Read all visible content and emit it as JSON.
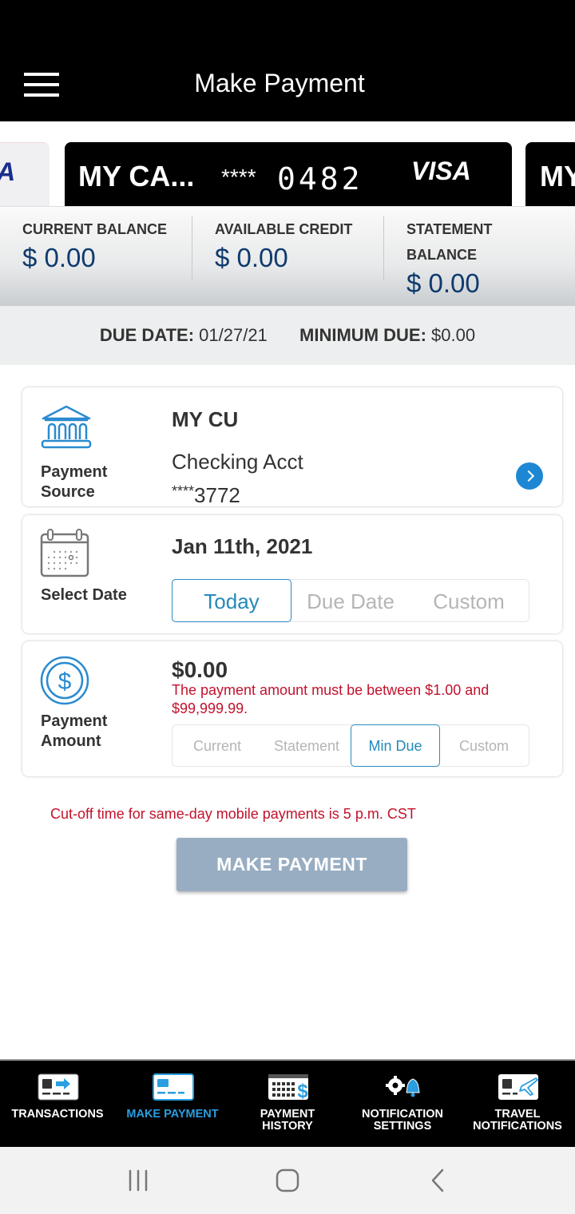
{
  "header": {
    "title": "Make Payment",
    "menu_icon": "hamburger-menu-icon"
  },
  "cards": {
    "prev_partial_brand": "A",
    "current": {
      "name": "MY CA...",
      "mask": "****",
      "last4": "0482",
      "brand": "VISA"
    },
    "next_partial_name": "MY"
  },
  "balances": {
    "current": {
      "label": "CURRENT BALANCE",
      "value": "$ 0.00"
    },
    "available": {
      "label": "AVAILABLE CREDIT",
      "value": "$ 0.00"
    },
    "statement": {
      "label_line1": "STATEMENT",
      "label_line2": "BALANCE",
      "value": "$ 0.00"
    }
  },
  "due": {
    "due_date_label": "DUE DATE:",
    "due_date_value": "01/27/21",
    "min_due_label": "MINIMUM DUE:",
    "min_due_value": "$0.00"
  },
  "payment_source": {
    "icon": "bank-icon",
    "label_line1": "Payment",
    "label_line2": "Source",
    "institution": "MY CU",
    "account_name": "Checking Acct",
    "account_mask": "****",
    "account_last4": "3772"
  },
  "select_date": {
    "icon": "calendar-icon",
    "label": "Select Date",
    "selected_date": "Jan 11th, 2021",
    "options": [
      "Today",
      "Due Date",
      "Custom"
    ],
    "active_option": "Today"
  },
  "payment_amount": {
    "icon": "dollar-coin-icon",
    "label_line1": "Payment",
    "label_line2": "Amount",
    "amount": "$0.00",
    "error": "The payment amount must be between $1.00 and $99,999.99.",
    "options": [
      "Current",
      "Statement",
      "Min Due",
      "Custom"
    ],
    "active_option": "Min Due"
  },
  "cutoff_notice": "Cut-off time for same-day mobile payments is 5 p.m. CST",
  "make_payment_button": "MAKE PAYMENT",
  "tabbar": {
    "items": [
      {
        "line1": "TRANSACTIONS",
        "line2": "",
        "icon": "transactions-icon"
      },
      {
        "line1": "MAKE PAYMENT",
        "line2": "",
        "icon": "make-payment-card-icon",
        "active": true
      },
      {
        "line1": "PAYMENT",
        "line2": "HISTORY",
        "icon": "payment-history-icon"
      },
      {
        "line1": "NOTIFICATION",
        "line2": "SETTINGS",
        "icon": "notification-settings-icon"
      },
      {
        "line1": "TRAVEL",
        "line2": "NOTIFICATIONS",
        "icon": "travel-notifications-icon"
      }
    ]
  },
  "colors": {
    "accent": "#2a9ee0",
    "error": "#c2122c",
    "balance_value": "#0f3a6e",
    "button_disabled": "#98adc2",
    "header_bg": "#000000"
  }
}
